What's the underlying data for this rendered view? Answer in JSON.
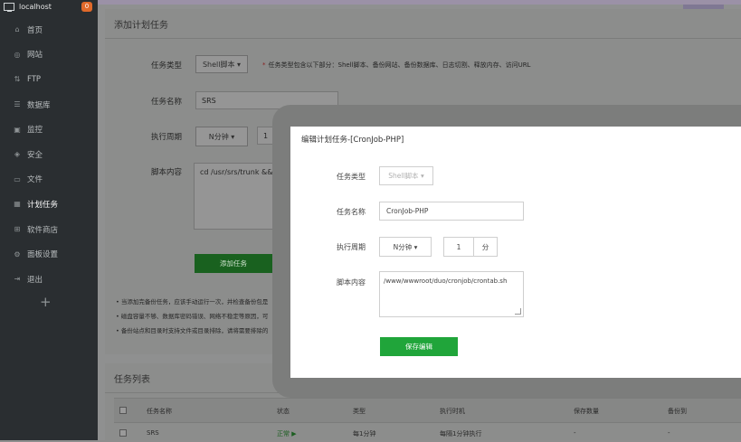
{
  "sidebar": {
    "host": "localhost",
    "badge": "0",
    "items": [
      {
        "label": "首页",
        "icon": "home-icon",
        "glyph": "⌂"
      },
      {
        "label": "网站",
        "icon": "globe-icon",
        "glyph": "◎"
      },
      {
        "label": "FTP",
        "icon": "ftp-icon",
        "glyph": "⇅"
      },
      {
        "label": "数据库",
        "icon": "database-icon",
        "glyph": "☰"
      },
      {
        "label": "监控",
        "icon": "monitor-icon",
        "glyph": "▣"
      },
      {
        "label": "安全",
        "icon": "shield-icon",
        "glyph": "◈"
      },
      {
        "label": "文件",
        "icon": "folder-icon",
        "glyph": "▭"
      },
      {
        "label": "计划任务",
        "icon": "calendar-icon",
        "glyph": "▦"
      },
      {
        "label": "软件商店",
        "icon": "apps-icon",
        "glyph": "⊞"
      },
      {
        "label": "面板设置",
        "icon": "gear-icon",
        "glyph": "⚙"
      },
      {
        "label": "退出",
        "icon": "logout-icon",
        "glyph": "⇥"
      }
    ],
    "add": "+"
  },
  "add_task": {
    "title": "添加计划任务",
    "type_label": "任务类型",
    "type_value": "Shell脚本",
    "type_hint": "任务类型包含以下部分：Shell脚本、备份网站、备份数据库、日志切割、释放内存、访问URL",
    "name_label": "任务名称",
    "name_value": "SRS",
    "period_label": "执行周期",
    "period_value": "N分钟",
    "period_num": "1",
    "script_label": "脚本内容",
    "script_value": "cd /usr/srs/trunk && ./objs/srs -c",
    "submit": "添加任务",
    "notes": [
      "当添加完备份任务，应该手动运行一次，并检查备份包是",
      "磁盘容量不够、数据库密码错误、网络不稳定等原因，可",
      "备份站点和目录时支持文件或目录排除，请将需要排除的"
    ]
  },
  "task_list": {
    "title": "任务列表",
    "columns": [
      "任务名称",
      "状态",
      "类型",
      "执行时机",
      "保存数量",
      "备份到"
    ],
    "rows": [
      {
        "name": "SRS",
        "status": "正常",
        "type": "每1分钟",
        "when": "每隔1分钟执行",
        "keep": "-",
        "backup": "-"
      }
    ]
  },
  "modal": {
    "title": "编辑计划任务-[CronJob-PHP]",
    "type_label": "任务类型",
    "type_value": "Shell脚本",
    "name_label": "任务名称",
    "name_value": "CronJob-PHP",
    "period_label": "执行周期",
    "period_value": "N分钟",
    "period_num": "1",
    "unit": "分",
    "script_label": "脚本内容",
    "script_value": "/www/wwwroot/duo/cronjob/crontab.sh",
    "save": "保存编辑"
  },
  "colors": {
    "green": "#20a53a",
    "sidebar": "#2a2e31",
    "badge": "#e0692a"
  }
}
